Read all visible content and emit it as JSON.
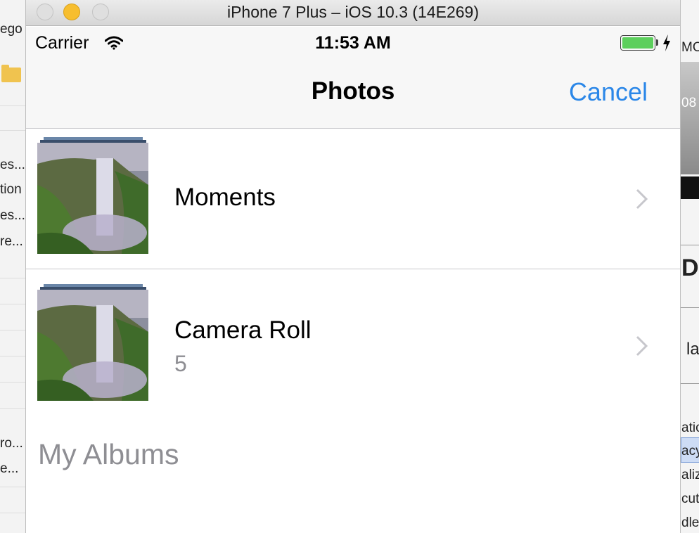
{
  "background": {
    "left_snippets": [
      "ego",
      "es...",
      "tion",
      "es...",
      "re...",
      "ro...",
      "e..."
    ],
    "right_snippets": [
      "MO",
      "08",
      "D",
      "la",
      "atio",
      "acy",
      "aliz",
      "cut",
      "dle"
    ]
  },
  "window": {
    "title": "iPhone 7 Plus – iOS 10.3 (14E269)"
  },
  "status_bar": {
    "carrier": "Carrier",
    "time": "11:53 AM",
    "battery_level": 1.0,
    "battery_color": "#5ccf5c",
    "charging": true
  },
  "nav": {
    "title": "Photos",
    "cancel_label": "Cancel",
    "accent_color": "#2b87e8"
  },
  "albums": [
    {
      "title": "Moments",
      "count": ""
    },
    {
      "title": "Camera Roll",
      "count": "5"
    }
  ],
  "section": {
    "my_albums": "My Albums"
  }
}
